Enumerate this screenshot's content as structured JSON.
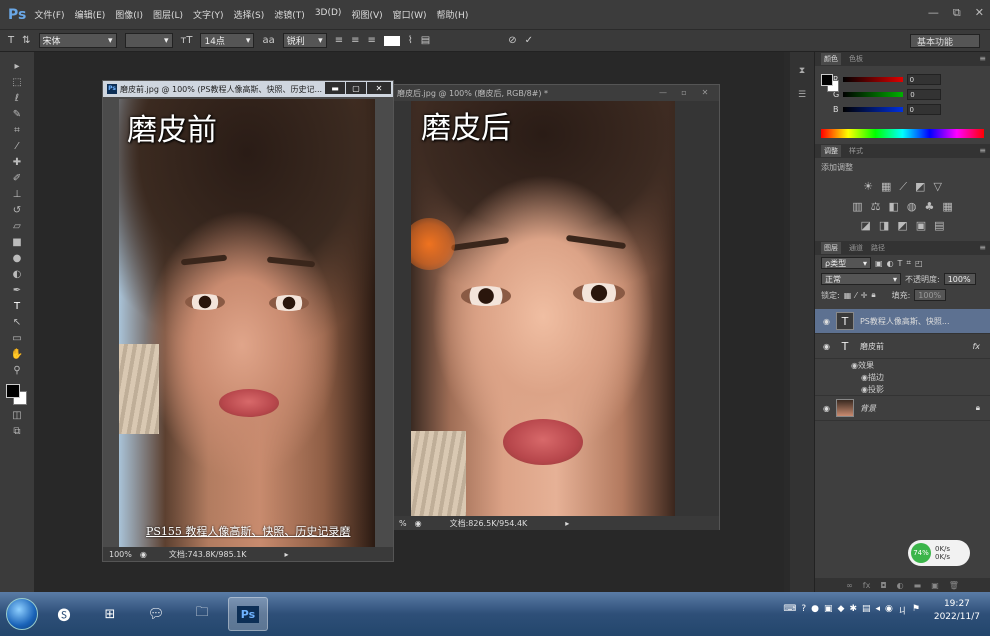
{
  "app": {
    "logo": "Ps"
  },
  "menu": [
    "文件(F)",
    "编辑(E)",
    "图像(I)",
    "图层(L)",
    "文字(Y)",
    "选择(S)",
    "滤镜(T)",
    "3D(D)",
    "视图(V)",
    "窗口(W)",
    "帮助(H)"
  ],
  "window_controls": {
    "minimize": "—",
    "restore": "⧉",
    "close": "✕"
  },
  "options_bar": {
    "font_family": "宋体",
    "font_size": "14点",
    "aa_label": "aa",
    "aa_mode": "锐利",
    "workspace": "基本功能"
  },
  "doc_left": {
    "title": "磨皮前.jpg @ 100% (PS教程人像高斯、快照、历史记...",
    "caption": "磨皮前",
    "watermark": "PS155 教程人像高斯、快照、历史记录磨",
    "zoom": "100%",
    "doc_info": "文档:743.8K/985.1K"
  },
  "doc_right": {
    "title": "磨皮后.jpg @ 100% (磨皮后, RGB/8#) *",
    "caption": "磨皮后",
    "zoom": "%",
    "doc_info": "文档:826.5K/954.4K"
  },
  "color_panel": {
    "tabs": [
      "颜色",
      "色板"
    ],
    "rows": [
      {
        "label": "R",
        "value": "0",
        "color": "#e00000"
      },
      {
        "label": "G",
        "value": "0",
        "color": "#00b000"
      },
      {
        "label": "B",
        "value": "0",
        "color": "#0030e0"
      }
    ]
  },
  "adjust_panel": {
    "tabs": [
      "调整",
      "样式"
    ],
    "title": "添加调整"
  },
  "layers_panel": {
    "tabs": [
      "图层",
      "通道",
      "路径"
    ],
    "kind_filter": "ρ类型",
    "blend_mode": "正常",
    "opacity_label": "不透明度:",
    "opacity": "100%",
    "lock_label": "锁定:",
    "fill_label": "填充:",
    "fill": "100%",
    "layers": [
      {
        "name": "PS教程人像高斯、快照...",
        "type": "T",
        "selected": true
      },
      {
        "name": "磨皮前",
        "type": "T",
        "selected": false,
        "fx": "fx"
      },
      {
        "name": "背景",
        "type": "img",
        "selected": false
      }
    ],
    "effects_label": "效果",
    "effects": [
      "描边",
      "投影"
    ]
  },
  "net_widget": {
    "percent": "74%",
    "up": "0K/s",
    "down": "0K/s"
  },
  "taskbar": {
    "ps_label": "Ps",
    "time": "19:27",
    "date": "2022/11/7"
  }
}
